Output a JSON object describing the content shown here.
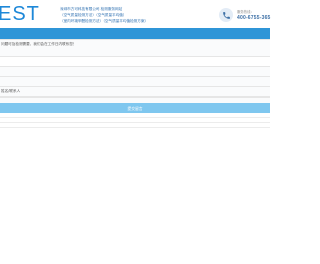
{
  "header": {
    "logo_text": "EST",
    "notes": [
      "深圳市方可科技有限公司 检测服务网站",
      "（空气质量检测方法）（空气质量平均值）",
      "（室内环境甲醛检测方法）（空气质量平均值检测方案）"
    ],
    "hotline_caption": "服务热线：",
    "hotline_number": "400-6755-365",
    "phone_icon": "phone-icon"
  },
  "form": {
    "message_text": "问题可及检测需要，我们会在工作日内联系您！",
    "message_placeholder": "",
    "name_placeholder": "",
    "phone_placeholder": "",
    "company_text": "姓名/联系人",
    "company_placeholder": "",
    "submit_label": "提交留言"
  },
  "colors": {
    "accent": "#2f95d7",
    "submit": "#7fc7ef",
    "logo": "#1e88d8"
  }
}
